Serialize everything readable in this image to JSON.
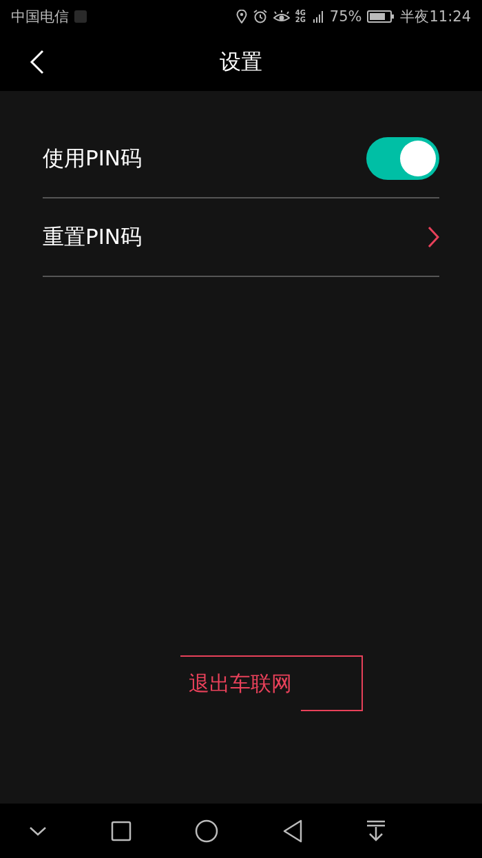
{
  "status_bar": {
    "carrier": "中国电信",
    "network": "4G 2G",
    "battery": "75%",
    "time": "半夜11:24"
  },
  "header": {
    "title": "设置"
  },
  "settings": [
    {
      "kind": "toggle",
      "label": "使用PIN码",
      "on": true
    },
    {
      "kind": "link",
      "label": "重置PIN码"
    }
  ],
  "logout_button": {
    "label": "退出车联网"
  }
}
